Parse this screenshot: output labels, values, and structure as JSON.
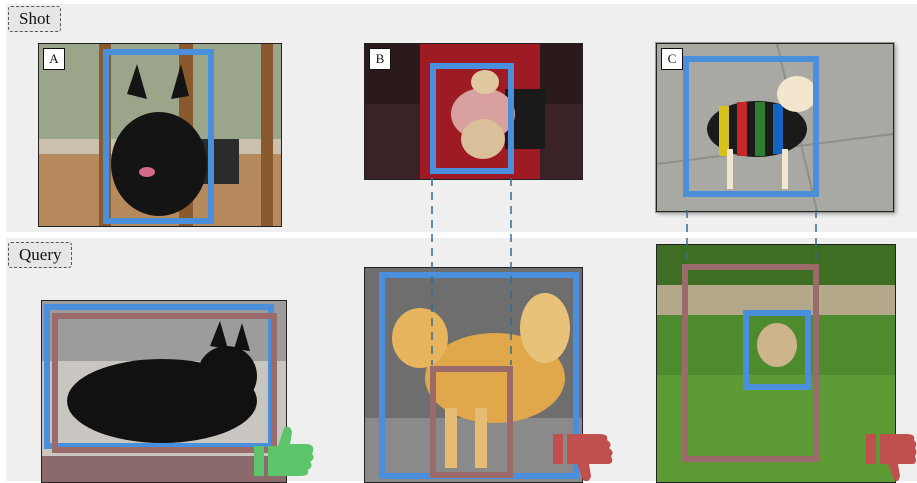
{
  "rows": {
    "shot_label": "Shot",
    "query_label": "Query"
  },
  "panels": [
    {
      "letter": "A",
      "feedback": "thumbs-up-icon"
    },
    {
      "letter": "B",
      "feedback": "thumbs-down-icon"
    },
    {
      "letter": "C",
      "feedback": "thumbs-down-icon"
    }
  ],
  "colors": {
    "shot_box": "#4a8fdb",
    "query_box": "#9b6a6a",
    "thumb_up": "#5cc46a",
    "thumb_down": "#c0504d"
  }
}
